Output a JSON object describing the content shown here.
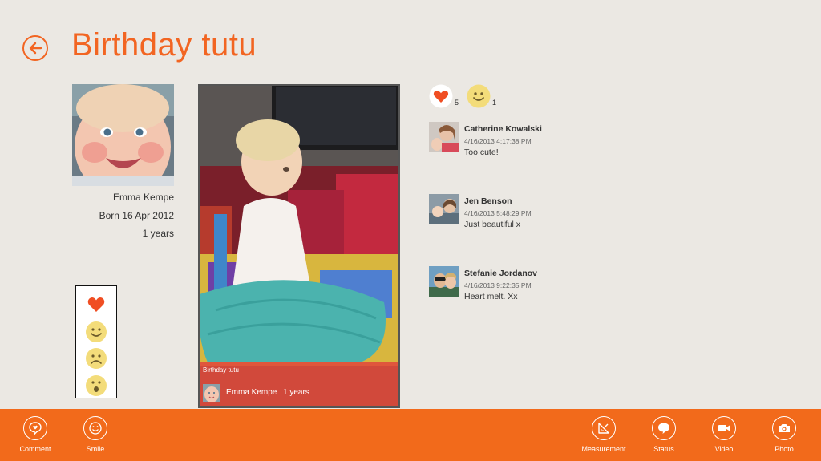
{
  "page": {
    "title": "Birthday tutu"
  },
  "profile": {
    "name": "Emma Kempe",
    "born": "Born 16 Apr 2012",
    "age": "1 years"
  },
  "photo": {
    "caption_title": "Birthday tutu",
    "caption_name": "Emma Kempe",
    "caption_age": "1 years"
  },
  "reaction_picker": {
    "icons": [
      "heart-icon",
      "smile-icon",
      "sad-icon",
      "surprised-icon"
    ]
  },
  "reactions": {
    "heart_count": "5",
    "smile_count": "1"
  },
  "comments": [
    {
      "name": "Catherine Kowalski",
      "time": "4/16/2013 4:17:38 PM",
      "text": "Too cute!"
    },
    {
      "name": "Jen Benson",
      "time": "4/16/2013 5:48:29 PM",
      "text": "Just beautiful x"
    },
    {
      "name": "Stefanie Jordanov",
      "time": "4/16/2013 9:22:35 PM",
      "text": "Heart melt. Xx"
    }
  ],
  "appbar": {
    "comment": "Comment",
    "smile": "Smile",
    "measurement": "Measurement",
    "status": "Status",
    "video": "Video",
    "photo": "Photo"
  },
  "colors": {
    "accent": "#f26522",
    "appbar": "#f26a1b",
    "heart": "#f04e23",
    "smiley": "#f3dc7a",
    "background": "#ebe8e3"
  }
}
